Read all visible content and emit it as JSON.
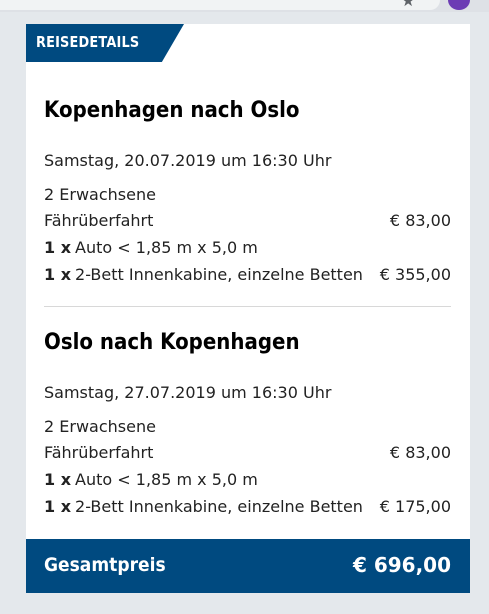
{
  "browser": {
    "star_glyph": "★"
  },
  "section_tab": "REISEDETAILS",
  "trips": [
    {
      "title": "Kopenhagen nach Oslo",
      "date": "Samstag, 20.07.2019 um 16:30 Uhr",
      "passengers": "2 Erwachsene",
      "crossing_label": "Fährüberfahrt",
      "crossing_price": "€ 83,00",
      "vehicle_qty": "1 x",
      "vehicle": "Auto < 1,85 m x 5,0 m",
      "cabin_qty": "1 x",
      "cabin": "2-Bett Innenkabine, einzelne Betten",
      "cabin_price": "€ 355,00"
    },
    {
      "title": "Oslo nach Kopenhagen",
      "date": "Samstag, 27.07.2019 um 16:30 Uhr",
      "passengers": "2 Erwachsene",
      "crossing_label": "Fährüberfahrt",
      "crossing_price": "€ 83,00",
      "vehicle_qty": "1 x",
      "vehicle": "Auto < 1,85 m x 5,0 m",
      "cabin_qty": "1 x",
      "cabin": "2-Bett Innenkabine, einzelne Betten",
      "cabin_price": "€ 175,00"
    }
  ],
  "total": {
    "label": "Gesamtpreis",
    "value": "€ 696,00"
  },
  "colors": {
    "brand_blue": "#004a80",
    "background": "#e4e8ec"
  }
}
